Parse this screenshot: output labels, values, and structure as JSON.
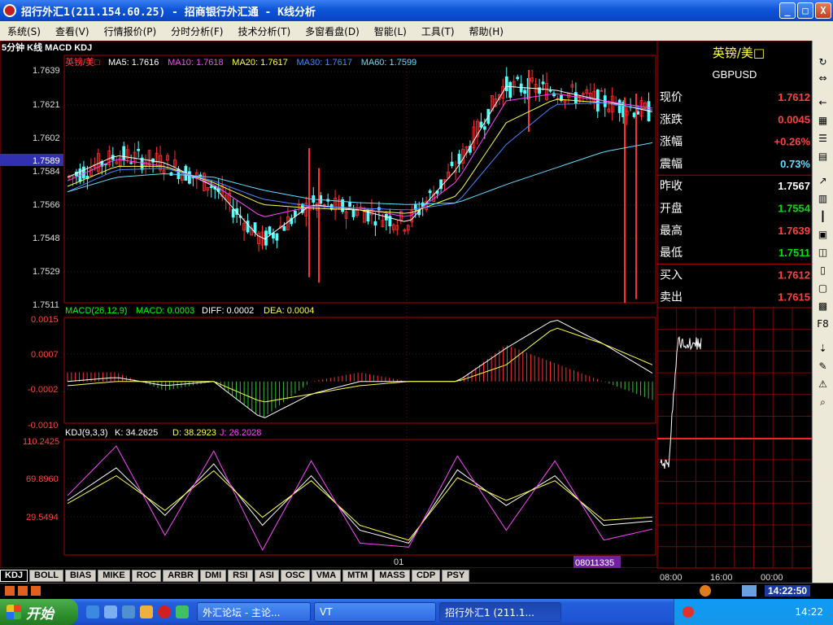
{
  "window": {
    "title": "招行外汇1(211.154.60.25) - 招商银行外汇通 - K线分析",
    "buttons": {
      "min": "_",
      "max": "□",
      "close": "X"
    }
  },
  "menu": [
    "系统(S)",
    "查看(V)",
    "行情报价(P)",
    "分时分析(F)",
    "技术分析(T)",
    "多窗看盘(D)",
    "智能(L)",
    "工具(T)",
    "帮助(H)"
  ],
  "chart": {
    "header": "5分钟 K线 MACD KDJ",
    "symbol_label": "英镑/美□",
    "ma": [
      {
        "name": "MA5",
        "value": "1.7616",
        "color": "#ffffff"
      },
      {
        "name": "MA10",
        "value": "1.7618",
        "color": "#ff44ff"
      },
      {
        "name": "MA20",
        "value": "1.7617",
        "color": "#ffff44"
      },
      {
        "name": "MA30",
        "value": "1.7617",
        "color": "#4488ff"
      },
      {
        "name": "MA60",
        "value": "1.7599",
        "color": "#66ddff"
      }
    ],
    "price_ticks": [
      "1.7639",
      "1.7621",
      "1.7602",
      "1.7584",
      "1.7566",
      "1.7548",
      "1.7529",
      "1.7511"
    ],
    "price_marker": "1.7589",
    "macd": {
      "label": "MACD(26,12,9)",
      "macd_text": "MACD: 0.0003",
      "diff_text": "DIFF: 0.0002",
      "dea_text": "DEA: 0.0004",
      "ticks": [
        "0.0015",
        "0.0007",
        "-0.0002",
        "-0.0010"
      ]
    },
    "kdj": {
      "label": "KDJ(9,3,3)",
      "k_text": "K: 34.2625",
      "d_text": "D: 38.2923",
      "j_text": "J: 26.2028",
      "ticks": [
        "110.2425",
        "69.8960",
        "29.5494"
      ]
    },
    "x_label": "01",
    "cursor_date": "08011335"
  },
  "chart_data": [
    {
      "type": "line",
      "title": "英镑/美□",
      "series": [
        {
          "name": "MA5",
          "values": [
            1.758,
            1.7592,
            1.7588,
            1.7575,
            1.7545,
            1.7565,
            1.7562,
            1.7555,
            1.7585,
            1.763,
            1.7628,
            1.7622,
            1.7616
          ]
        },
        {
          "name": "MA10",
          "values": [
            1.7578,
            1.759,
            1.7586,
            1.7576,
            1.7558,
            1.7564,
            1.7563,
            1.7558,
            1.7578,
            1.7622,
            1.7626,
            1.7622,
            1.7618
          ]
        },
        {
          "name": "MA20",
          "values": [
            1.7575,
            1.7586,
            1.7586,
            1.7577,
            1.7565,
            1.7563,
            1.7562,
            1.756,
            1.757,
            1.761,
            1.7623,
            1.7621,
            1.7617
          ]
        },
        {
          "name": "MA30",
          "values": [
            1.7572,
            1.7584,
            1.7585,
            1.7578,
            1.7568,
            1.7564,
            1.7563,
            1.7562,
            1.7566,
            1.7598,
            1.762,
            1.7621,
            1.7617
          ]
        },
        {
          "name": "MA60",
          "values": [
            1.7572,
            1.758,
            1.7582,
            1.758,
            1.7573,
            1.7568,
            1.7566,
            1.7565,
            1.7566,
            1.7576,
            1.7585,
            1.7594,
            1.7599
          ]
        }
      ],
      "ylim": [
        1.7511,
        1.7639
      ]
    },
    {
      "type": "bar",
      "title": "MACD(26,12,9)",
      "series": [
        {
          "name": "DIFF",
          "values": [
            0.0,
            0.0001,
            -0.0001,
            0.0,
            -0.0009,
            -0.0003,
            0.0,
            0.0,
            0.0,
            0.0008,
            0.0015,
            0.0009,
            0.0002
          ]
        },
        {
          "name": "DEA",
          "values": [
            -0.0001,
            0.0,
            0.0,
            0.0,
            -0.0005,
            -0.0003,
            -0.0001,
            0.0,
            0.0,
            0.0004,
            0.0013,
            0.0009,
            0.0004
          ]
        }
      ],
      "ylim": [
        -0.001,
        0.0015
      ]
    },
    {
      "type": "line",
      "title": "KDJ(9,3,3)",
      "series": [
        {
          "name": "K",
          "values": [
            55,
            88,
            40,
            92,
            30,
            80,
            25,
            12,
            86,
            50,
            80,
            30,
            34.26
          ]
        },
        {
          "name": "D",
          "values": [
            52,
            80,
            45,
            85,
            38,
            75,
            30,
            15,
            78,
            55,
            75,
            35,
            38.29
          ]
        },
        {
          "name": "J",
          "values": [
            60,
            110,
            20,
            105,
            5,
            95,
            12,
            8,
            100,
            25,
            95,
            15,
            26.2
          ]
        }
      ],
      "ylim": [
        29.5494,
        110.2425
      ]
    }
  ],
  "quote": {
    "name": "英镑/美□",
    "code": "GBPUSD",
    "rows": [
      {
        "label": "现价",
        "value": "1.7612",
        "color": "#ff4040"
      },
      {
        "label": "涨跌",
        "value": "0.0045",
        "color": "#ff4040"
      },
      {
        "label": "涨幅",
        "value": "+0.26%",
        "color": "#ff4040"
      },
      {
        "label": "震幅",
        "value": "0.73%",
        "color": "#66ddff"
      },
      {
        "label": "昨收",
        "value": "1.7567",
        "color": "#ffffff"
      },
      {
        "label": "开盘",
        "value": "1.7554",
        "color": "#00dd00"
      },
      {
        "label": "最高",
        "value": "1.7639",
        "color": "#ff4040"
      },
      {
        "label": "最低",
        "value": "1.7511",
        "color": "#00dd00"
      },
      {
        "label": "买入",
        "value": "1.7612",
        "color": "#ff4040"
      },
      {
        "label": "卖出",
        "value": "1.7615",
        "color": "#ff4040"
      }
    ],
    "time_labels": [
      "08:00",
      "16:00",
      "00:00"
    ]
  },
  "tabs": [
    "KDJ",
    "BOLL",
    "BIAS",
    "MIKE",
    "ROC",
    "ARBR",
    "DMI",
    "RSI",
    "ASI",
    "OSC",
    "VMA",
    "MTM",
    "MASS",
    "CDP",
    "PSY"
  ],
  "status": {
    "time": "14:22:50"
  },
  "taskbar": {
    "start": "开始",
    "tasks": [
      "外汇论坛 - 主论...",
      "VT",
      "招行外汇1 (211.1..."
    ],
    "clock": "14:22"
  },
  "colors": {
    "up": "#ff3030",
    "down": "#54ffff",
    "grid": "#800000",
    "frame": "#b00000"
  }
}
